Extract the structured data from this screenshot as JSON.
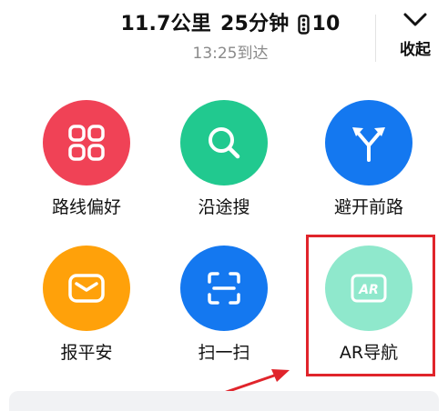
{
  "header": {
    "distance": "11.7公里",
    "duration": "25分钟",
    "traffic_lights_count": "10",
    "arrival": "13:25到达",
    "collapse_label": "收起",
    "traffic_light_icon": "traffic-light-icon",
    "collapse_icon": "chevron-down-icon"
  },
  "actions": [
    {
      "label": "路线偏好",
      "icon": "grid-icon",
      "color": "#f04256"
    },
    {
      "label": "沿途搜",
      "icon": "search-icon",
      "color": "#21c98f"
    },
    {
      "label": "避开前路",
      "icon": "split-route-icon",
      "color": "#1478f0"
    },
    {
      "label": "报平安",
      "icon": "envelope-icon",
      "color": "#ffa10a"
    },
    {
      "label": "扫一扫",
      "icon": "scan-icon",
      "color": "#1478f0"
    },
    {
      "label": "AR导航",
      "icon": "ar-icon",
      "color": "#8fe8cc"
    }
  ],
  "annotation": {
    "highlight_color": "#e0242b"
  }
}
